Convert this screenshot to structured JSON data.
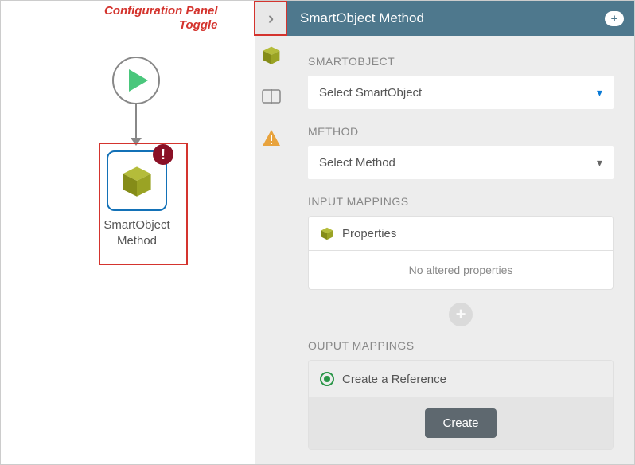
{
  "annotation": "Configuration Panel\nToggle",
  "canvas": {
    "node_label": "SmartObject\nMethod"
  },
  "panel": {
    "title": "SmartObject Method",
    "sections": {
      "smartobject": {
        "label": "SMARTOBJECT",
        "placeholder": "Select SmartObject"
      },
      "method": {
        "label": "METHOD",
        "placeholder": "Select Method"
      },
      "input_mappings": {
        "label": "INPUT MAPPINGS",
        "header": "Properties",
        "empty_text": "No altered properties"
      },
      "output_mappings": {
        "label": "OUPUT MAPPINGS",
        "radio_label": "Create a Reference",
        "button": "Create"
      }
    }
  }
}
